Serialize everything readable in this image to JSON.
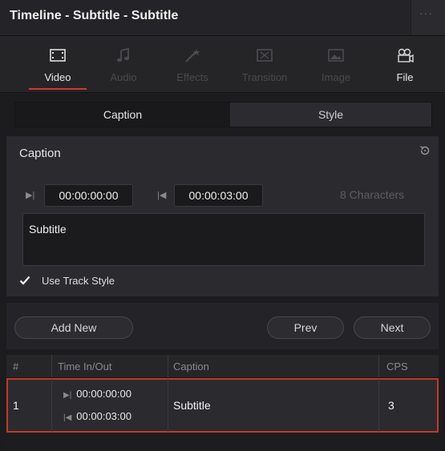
{
  "window": {
    "title": "Timeline - Subtitle - Subtitle",
    "menu_glyph": "···"
  },
  "tool_tabs": [
    {
      "label": "Video",
      "icon": "video-frame-icon",
      "state": "active"
    },
    {
      "label": "Audio",
      "icon": "music-note-icon",
      "state": "disabled"
    },
    {
      "label": "Effects",
      "icon": "magic-wand-icon",
      "state": "disabled"
    },
    {
      "label": "Transition",
      "icon": "transition-icon",
      "state": "disabled"
    },
    {
      "label": "Image",
      "icon": "image-icon",
      "state": "disabled"
    },
    {
      "label": "File",
      "icon": "file-reel-icon",
      "state": "enabled"
    }
  ],
  "segment": {
    "caption_label": "Caption",
    "style_label": "Style",
    "selected": "Caption"
  },
  "caption": {
    "heading": "Caption",
    "in_timecode": "00:00:00:00",
    "out_timecode": "00:00:03:00",
    "char_count": "8 Characters",
    "text": "Subtitle",
    "use_track_style_label": "Use Track Style",
    "use_track_style_checked": true
  },
  "buttons": {
    "add_new": "Add New",
    "prev": "Prev",
    "next": "Next"
  },
  "table": {
    "headers": [
      "#",
      "Time In/Out",
      "Caption",
      "CPS"
    ],
    "rows": [
      {
        "index": "1",
        "time_in": "00:00:00:00",
        "time_out": "00:00:03:00",
        "caption": "Subtitle",
        "cps": "3",
        "selected": true
      }
    ]
  },
  "colors": {
    "accent": "#d0392b",
    "selection_border": "#c0392b",
    "panel_bg": "#2b2b2f"
  }
}
